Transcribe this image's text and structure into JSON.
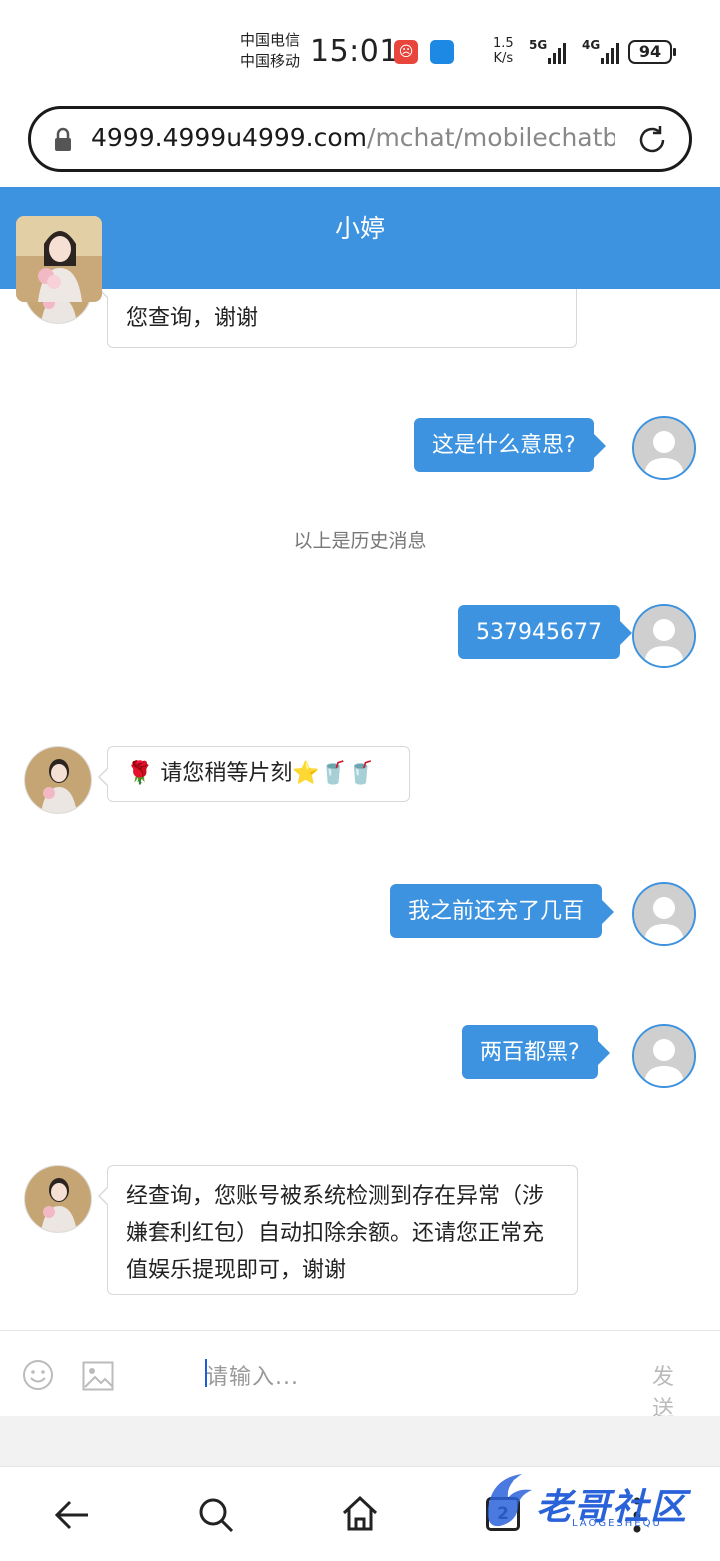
{
  "status_bar": {
    "carrier_1": "中国电信",
    "carrier_2": "中国移动",
    "time": "15:01",
    "net_speed_value": "1.5",
    "net_speed_unit": "K/s",
    "signal_1": "5G",
    "signal_2": "4G",
    "battery": "94"
  },
  "browser": {
    "url_host": "4999.4999u4999.com",
    "url_path": "/mchat/mobilechatb"
  },
  "chat": {
    "title": "小婷",
    "history_label": "以上是历史消息",
    "messages": [
      {
        "side": "agent",
        "text": "您查询，谢谢"
      },
      {
        "side": "user",
        "text": "这是什么意思?"
      },
      {
        "side": "user",
        "text": "537945677"
      },
      {
        "side": "agent",
        "text": "🌹 请您稍等片刻⭐🥤🥤"
      },
      {
        "side": "user",
        "text": "我之前还充了几百"
      },
      {
        "side": "user",
        "text": "两百都黑?"
      },
      {
        "side": "agent",
        "text": "经查询，您账号被系统检测到存在异常（涉嫌套利红包）自动扣除余额。还请您正常充值娱乐提现即可，谢谢"
      }
    ]
  },
  "input": {
    "placeholder": "请输入...",
    "send_label": "发 送"
  },
  "nav": {
    "tab_count": "2"
  },
  "watermark": {
    "text": "老哥社区",
    "sub": "LAOGESHEQU"
  },
  "colors": {
    "accent": "#3d93df"
  }
}
